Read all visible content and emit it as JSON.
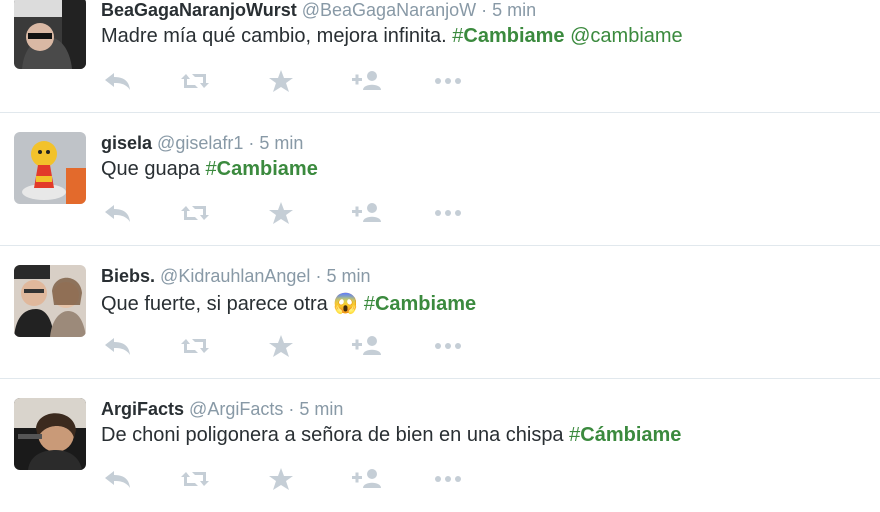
{
  "tweets": [
    {
      "name": "BeaGagaNaranjoWurst",
      "handle": "@BeaGagaNaranjoW",
      "sep": "·",
      "time": "5 min",
      "text": "Madre mía qué cambio, mejora infinita.",
      "hashtag_symbol": "#",
      "hashtag_word": "Cambiame",
      "mention": "@cambiame",
      "emoji": ""
    },
    {
      "name": "gisela",
      "handle": "@giselafr1",
      "sep": "·",
      "time": "5 min",
      "text": "Que guapa",
      "hashtag_symbol": "#",
      "hashtag_word": "Cambiame",
      "mention": "",
      "emoji": ""
    },
    {
      "name": "Biebs.",
      "handle": "@KidrauhlanAngel",
      "sep": "·",
      "time": "5 min",
      "text": "Que fuerte, si parece otra",
      "hashtag_symbol": "#",
      "hashtag_word": "Cambiame",
      "mention": "",
      "emoji": "😱"
    },
    {
      "name": "ArgiFacts",
      "handle": "@ArgiFacts",
      "sep": "·",
      "time": "5 min",
      "text": "De choni poligonera a señora de bien en una chispa",
      "hashtag_symbol": "#",
      "hashtag_word": "Cámbiame",
      "mention": "",
      "emoji": ""
    }
  ],
  "colors": {
    "hashtag": "#3b8a3e",
    "meta": "#8899a6",
    "icon": "#c5ced6",
    "divider": "#e1e8ed"
  },
  "icons": [
    "reply-icon",
    "retweet-icon",
    "favorite-icon",
    "follow-icon",
    "more-icon"
  ]
}
